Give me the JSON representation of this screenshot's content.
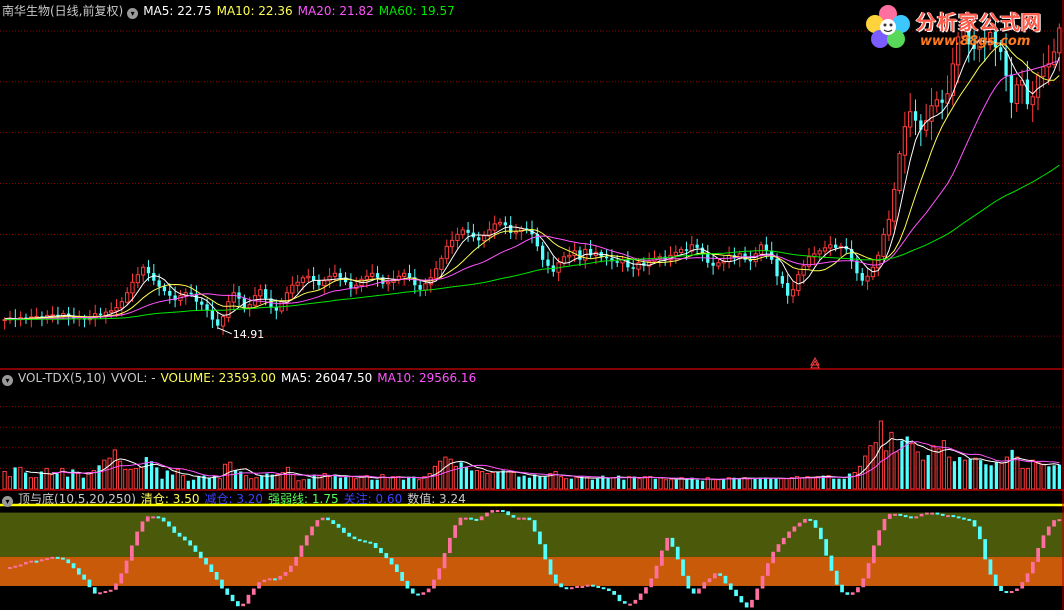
{
  "price_panel": {
    "name": "南华生物(日线,前复权)",
    "ma_labels": [
      {
        "text": "MA5: 22.75",
        "color": "#ffffff"
      },
      {
        "text": "MA10: 22.36",
        "color": "#ffff54"
      },
      {
        "text": "MA20: 21.82",
        "color": "#ff54ff"
      },
      {
        "text": "MA60: 19.57",
        "color": "#00e600"
      }
    ],
    "low_label": "14.91"
  },
  "volume_panel": {
    "legend": [
      {
        "text": "VOL-TDX(5,10)",
        "color": "#c8c8c8"
      },
      {
        "text": "VVOL: -",
        "color": "#c8c8c8"
      },
      {
        "text": "VOLUME: 23593.00",
        "color": "#ffff54"
      },
      {
        "text": "MA5: 26047.50",
        "color": "#ffffff"
      },
      {
        "text": "MA10: 29566.16",
        "color": "#ff54ff"
      }
    ]
  },
  "indicator_panel": {
    "legend": [
      {
        "text": "顶与底(10,5,20,250)",
        "color": "#c8c8c8"
      },
      {
        "text": "清仓: 3.50",
        "color": "#ffff54"
      },
      {
        "text": "减仓: 3.20",
        "color": "#4040ff"
      },
      {
        "text": "强弱线: 1.75",
        "color": "#54ff54"
      },
      {
        "text": "关注: 0.60",
        "color": "#4040ff"
      },
      {
        "text": "数值: 3.24",
        "color": "#c8c8c8"
      }
    ]
  },
  "logo": {
    "title": "分析家公式网",
    "url": "www.88gs.com"
  },
  "colors": {
    "up": "#ff3c3c",
    "down": "#54ffff",
    "grid": "#8b0000",
    "border": "#b00000",
    "ma5": "#ffffff",
    "ma10": "#ffff54",
    "ma20": "#ff54ff",
    "ma60": "#00e600",
    "band_upper": "#4b5a0a",
    "band_lower": "#c85a0a",
    "clear_line": "#ffff00",
    "ind_up": "#ff70a0",
    "ind_down": "#54ffff"
  },
  "chart_data": [
    {
      "type": "candlestick",
      "title": "南华生物(日线,前复权)",
      "ylim": [
        13.5,
        25.2
      ],
      "y_gridlines": [
        14.5,
        16.2,
        17.9,
        19.6,
        21.3,
        23.0,
        24.7
      ],
      "low_marker": 14.91,
      "moving_averages": {
        "MA5": 22.75,
        "MA10": 22.36,
        "MA20": 21.82,
        "MA60": 19.57
      },
      "series": [
        {
          "name": "close",
          "values": [
            15.05,
            15.1,
            15.07,
            15.12,
            15.09,
            15.14,
            15.16,
            15.12,
            15.19,
            15.21,
            15.17,
            15.25,
            15.15,
            15.08,
            15.12,
            15.05,
            15.12,
            15.25,
            15.2,
            15.3,
            15.35,
            15.45,
            15.65,
            15.95,
            16.3,
            16.55,
            16.8,
            16.6,
            16.35,
            16.15,
            16.0,
            15.85,
            15.7,
            15.85,
            15.95,
            15.9,
            15.65,
            15.55,
            15.35,
            15.05,
            14.85,
            15.15,
            15.65,
            15.95,
            15.75,
            15.45,
            15.55,
            15.85,
            16.05,
            15.75,
            15.45,
            15.35,
            15.65,
            15.95,
            16.2,
            16.3,
            16.45,
            16.5,
            16.35,
            16.2,
            16.35,
            16.5,
            16.6,
            16.45,
            16.3,
            16.1,
            16.2,
            16.4,
            16.5,
            16.6,
            16.45,
            16.25,
            16.3,
            16.4,
            16.5,
            16.6,
            16.45,
            16.2,
            16.05,
            16.25,
            16.45,
            16.75,
            17.1,
            17.5,
            17.7,
            17.9,
            18.05,
            17.95,
            17.8,
            17.7,
            17.85,
            18.05,
            18.25,
            18.3,
            18.2,
            17.95,
            18.0,
            18.1,
            18.05,
            17.9,
            17.5,
            17.05,
            16.85,
            16.65,
            16.95,
            17.15,
            17.2,
            17.35,
            17.05,
            17.4,
            17.2,
            17.3,
            17.15,
            17.1,
            17.0,
            16.95,
            17.05,
            16.8,
            16.75,
            16.95,
            16.85,
            17.0,
            17.1,
            17.15,
            17.05,
            17.2,
            17.3,
            17.4,
            17.35,
            17.55,
            17.45,
            17.25,
            16.95,
            16.85,
            16.95,
            17.0,
            17.2,
            17.1,
            17.25,
            17.05,
            17.0,
            17.25,
            17.55,
            17.35,
            17.05,
            16.5,
            16.25,
            15.85,
            16.05,
            16.55,
            16.85,
            17.15,
            17.25,
            17.35,
            17.45,
            17.55,
            17.45,
            17.5,
            17.4,
            17.0,
            16.6,
            16.35,
            16.5,
            16.8,
            17.2,
            17.9,
            18.4,
            19.4,
            20.6,
            21.5,
            22.0,
            21.7,
            21.4,
            21.7,
            22.2,
            22.4,
            22.3,
            22.6,
            23.6,
            24.5,
            24.7,
            24.25,
            24.1,
            24.4,
            24.25,
            24.65,
            24.15,
            24.0,
            23.2,
            22.3,
            22.9,
            23.05,
            22.25,
            22.5,
            23.2,
            23.5,
            23.6,
            24.0,
            24.8
          ]
        }
      ]
    },
    {
      "type": "bar",
      "title": "VOL-TDX(5,10)",
      "ylim": [
        0,
        100000
      ],
      "last_values": {
        "VOLUME": 23593.0,
        "MA5": 26047.5,
        "MA10": 29566.16
      },
      "series": [
        {
          "name": "VOLUME",
          "values": [
            17000,
            12000,
            21000,
            21000,
            16000,
            11000,
            11000,
            17000,
            20000,
            14000,
            15000,
            20000,
            12000,
            19000,
            15000,
            11000,
            16000,
            18000,
            23000,
            28000,
            30000,
            38000,
            27000,
            19000,
            19000,
            20000,
            21000,
            31000,
            27000,
            21000,
            10000,
            18000,
            14000,
            19000,
            13000,
            8000,
            9000,
            12000,
            13000,
            11000,
            13000,
            10000,
            24000,
            26000,
            18000,
            17000,
            13000,
            10000,
            11000,
            13000,
            15000,
            14000,
            14000,
            16000,
            21000,
            14000,
            8000,
            9000,
            10000,
            14000,
            13000,
            15000,
            12000,
            14000,
            11000,
            12000,
            12000,
            10000,
            12000,
            13000,
            9000,
            9000,
            14000,
            11000,
            12000,
            12000,
            9000,
            12000,
            12000,
            9000,
            12000,
            15000,
            22000,
            27000,
            31000,
            29000,
            22000,
            26000,
            21000,
            18000,
            18000,
            17000,
            15000,
            16000,
            17000,
            18000,
            17000,
            16000,
            12000,
            13000,
            11000,
            14000,
            12000,
            12000,
            15000,
            17000,
            12000,
            10000,
            10000,
            11000,
            12000,
            11000,
            9000,
            10000,
            13000,
            11000,
            11000,
            13000,
            9000,
            12000,
            12000,
            10000,
            12000,
            12000,
            10000,
            11000,
            9000,
            9000,
            9000,
            11000,
            9000,
            11000,
            9000,
            8000,
            11000,
            9000,
            9000,
            10000,
            11000,
            11000,
            10000,
            11000,
            10000,
            10000,
            11000,
            11000,
            10000,
            10000,
            10000,
            10000,
            11000,
            12000,
            11000,
            12000,
            11000,
            12000,
            13000,
            13000,
            10000,
            10000,
            10000,
            15000,
            16000,
            22000,
            32000,
            42000,
            45000,
            66000,
            37000,
            55000,
            36000,
            47000,
            51000,
            44000,
            36000,
            28000,
            33000,
            42000,
            39000,
            47000,
            31000,
            27000,
            31000,
            28000,
            29000,
            30000,
            28000,
            24000,
            23000,
            26000,
            25000,
            31000,
            38000,
            31000,
            20000,
            20000,
            28000,
            26000,
            24000,
            22000,
            23000,
            23593
          ]
        }
      ]
    },
    {
      "type": "bar",
      "title": "顶与底(10,5,20,250)",
      "ylim": [
        -0.35,
        3.8
      ],
      "reference_lines": {
        "清仓": 3.5,
        "减仓": 3.2,
        "强弱线": 1.75,
        "关注": 0.6
      },
      "last_value": 3.24,
      "series": [
        {
          "name": "数值",
          "values": [
            1.3,
            1.35,
            1.4,
            1.45,
            1.55,
            1.6,
            1.58,
            1.65,
            1.7,
            1.75,
            1.72,
            1.65,
            1.5,
            1.3,
            1.05,
            0.85,
            0.55,
            0.3,
            0.35,
            0.4,
            0.45,
            0.7,
            1.1,
            1.6,
            2.2,
            2.75,
            3.15,
            3.35,
            3.35,
            3.3,
            3.15,
            2.95,
            2.7,
            2.55,
            2.4,
            2.2,
            1.95,
            1.7,
            1.45,
            1.15,
            0.85,
            0.5,
            0.25,
            0.0,
            -0.2,
            -0.1,
            0.25,
            0.5,
            0.75,
            0.85,
            0.9,
            0.85,
            1.0,
            1.15,
            1.4,
            1.75,
            2.2,
            2.6,
            2.95,
            3.2,
            3.3,
            3.2,
            3.05,
            2.9,
            2.7,
            2.55,
            2.45,
            2.4,
            2.35,
            2.3,
            2.1,
            1.9,
            1.7,
            1.45,
            1.15,
            0.8,
            0.5,
            0.3,
            0.25,
            0.35,
            0.5,
            0.85,
            1.3,
            1.9,
            2.5,
            3.0,
            3.3,
            3.3,
            3.25,
            3.2,
            3.35,
            3.5,
            3.6,
            3.6,
            3.55,
            3.4,
            3.3,
            3.3,
            3.3,
            3.2,
            2.75,
            2.25,
            1.65,
            1.05,
            0.7,
            0.55,
            0.5,
            0.55,
            0.6,
            0.6,
            0.65,
            0.6,
            0.55,
            0.5,
            0.4,
            0.25,
            0.0,
            -0.1,
            -0.1,
            0.05,
            0.3,
            0.55,
            0.9,
            1.4,
            2.0,
            2.5,
            2.15,
            1.65,
            1.0,
            0.5,
            0.3,
            0.5,
            0.75,
            0.9,
            1.1,
            1.0,
            0.7,
            0.45,
            0.2,
            -0.05,
            -0.25,
            0.05,
            0.5,
            1.0,
            1.5,
            1.95,
            2.25,
            2.5,
            2.75,
            2.95,
            3.1,
            3.25,
            3.2,
            2.9,
            2.45,
            1.8,
            1.2,
            0.65,
            0.35,
            0.25,
            0.35,
            0.55,
            0.9,
            1.5,
            2.2,
            2.8,
            3.25,
            3.45,
            3.45,
            3.4,
            3.35,
            3.3,
            3.35,
            3.45,
            3.5,
            3.5,
            3.45,
            3.4,
            3.4,
            3.35,
            3.3,
            3.25,
            3.2,
            2.95,
            2.45,
            1.65,
            1.05,
            0.6,
            0.4,
            0.35,
            0.4,
            0.5,
            0.75,
            1.1,
            1.55,
            2.1,
            2.6,
            2.95,
            3.2,
            3.24
          ]
        }
      ]
    }
  ]
}
